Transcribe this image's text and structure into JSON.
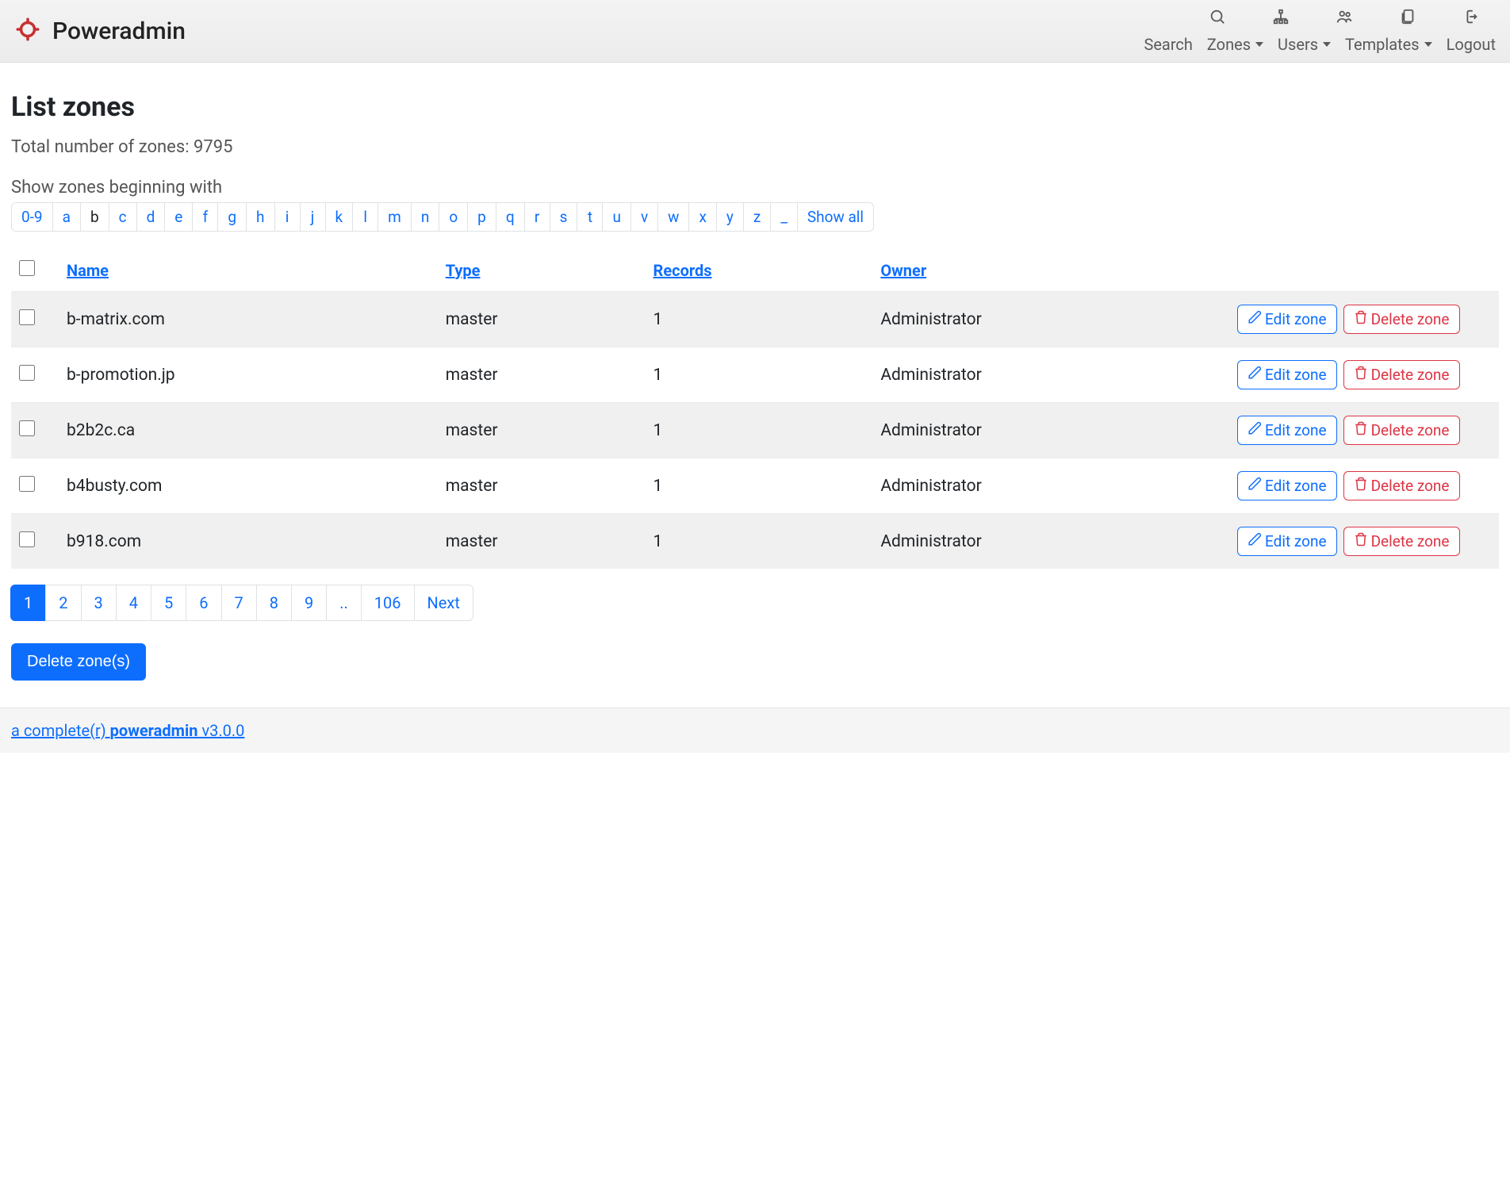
{
  "brand": "Poweradmin",
  "nav": {
    "search": "Search",
    "zones": "Zones",
    "users": "Users",
    "templates": "Templates",
    "logout": "Logout"
  },
  "page_title": "List zones",
  "total_label": "Total number of zones: 9795",
  "filter_label": "Show zones beginning with",
  "filters": [
    "0-9",
    "a",
    "b",
    "c",
    "d",
    "e",
    "f",
    "g",
    "h",
    "i",
    "j",
    "k",
    "l",
    "m",
    "n",
    "o",
    "p",
    "q",
    "r",
    "s",
    "t",
    "u",
    "v",
    "w",
    "x",
    "y",
    "z",
    "_",
    "Show all"
  ],
  "active_filter": "b",
  "columns": {
    "name": "Name",
    "type": "Type",
    "records": "Records",
    "owner": "Owner"
  },
  "edit_label": "Edit zone",
  "delete_label": "Delete zone",
  "zones": [
    {
      "name": "b-matrix.com",
      "type": "master",
      "records": "1",
      "owner": "Administrator"
    },
    {
      "name": "b-promotion.jp",
      "type": "master",
      "records": "1",
      "owner": "Administrator"
    },
    {
      "name": "b2b2c.ca",
      "type": "master",
      "records": "1",
      "owner": "Administrator"
    },
    {
      "name": "b4busty.com",
      "type": "master",
      "records": "1",
      "owner": "Administrator"
    },
    {
      "name": "b918.com",
      "type": "master",
      "records": "1",
      "owner": "Administrator"
    }
  ],
  "pagination": {
    "pages": [
      "1",
      "2",
      "3",
      "4",
      "5",
      "6",
      "7",
      "8",
      "9",
      "..",
      "106",
      "Next"
    ],
    "active": "1"
  },
  "delete_zones_btn": "Delete zone(s)",
  "footer": {
    "prefix": "a complete(r) ",
    "bold": "poweradmin",
    "version": " v3.0.0"
  }
}
